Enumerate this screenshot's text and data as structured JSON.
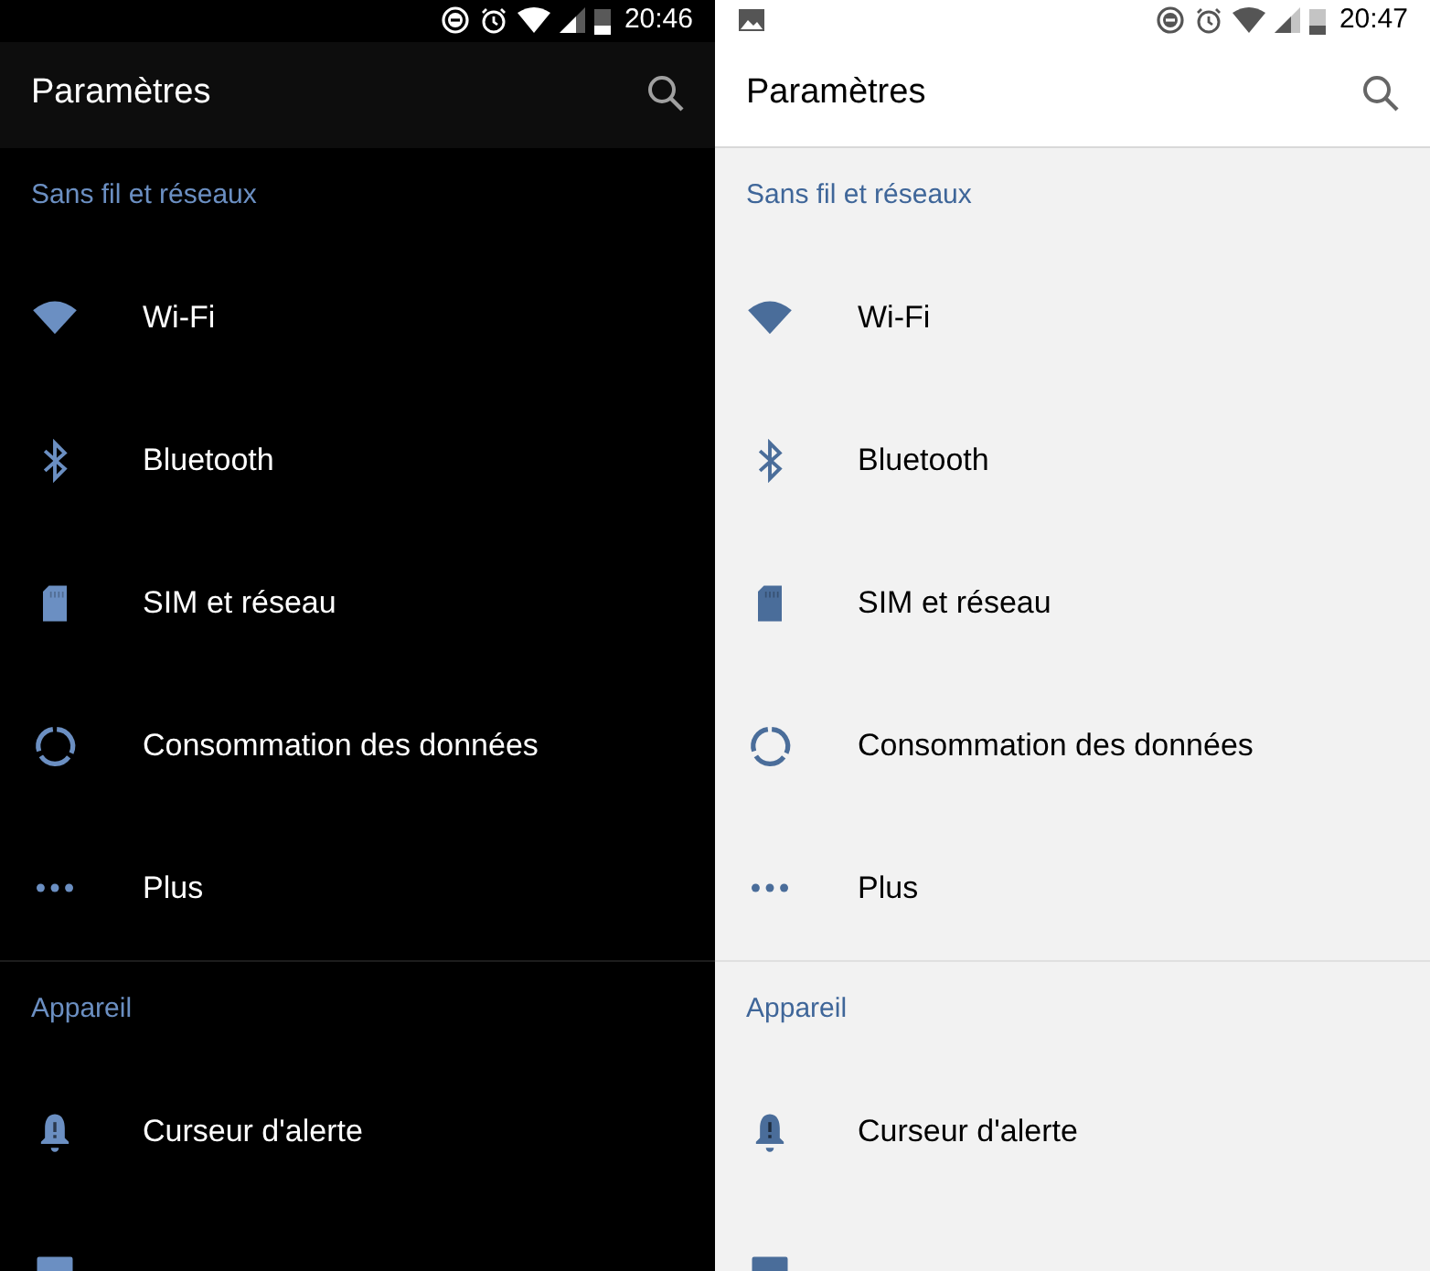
{
  "panels": [
    {
      "dark_mode": true,
      "status_bar": {
        "image_notification": false,
        "time": "20:46"
      },
      "title": "Paramètres",
      "sections": [
        {
          "header": "Sans fil et réseaux",
          "items": [
            {
              "kind": "wifi",
              "label": "Wi-Fi"
            },
            {
              "kind": "bluetooth",
              "label": "Bluetooth"
            },
            {
              "kind": "sim",
              "label": "SIM et réseau"
            },
            {
              "kind": "data",
              "label": "Consommation des données"
            },
            {
              "kind": "more",
              "label": "Plus"
            }
          ]
        },
        {
          "header": "Appareil",
          "items": [
            {
              "kind": "bell",
              "label": "Curseur d'alerte"
            },
            {
              "kind": "display"
            }
          ]
        }
      ]
    },
    {
      "dark_mode": false,
      "status_bar": {
        "image_notification": true,
        "time": "20:47"
      },
      "title": "Paramètres",
      "sections": [
        {
          "header": "Sans fil et réseaux",
          "items": [
            {
              "kind": "wifi",
              "label": "Wi-Fi"
            },
            {
              "kind": "bluetooth",
              "label": "Bluetooth"
            },
            {
              "kind": "sim",
              "label": "SIM et réseau"
            },
            {
              "kind": "data",
              "label": "Consommation des données"
            },
            {
              "kind": "more",
              "label": "Plus"
            }
          ]
        },
        {
          "header": "Appareil",
          "items": [
            {
              "kind": "bell",
              "label": "Curseur d'alerte"
            },
            {
              "kind": "display"
            }
          ]
        }
      ]
    }
  ]
}
